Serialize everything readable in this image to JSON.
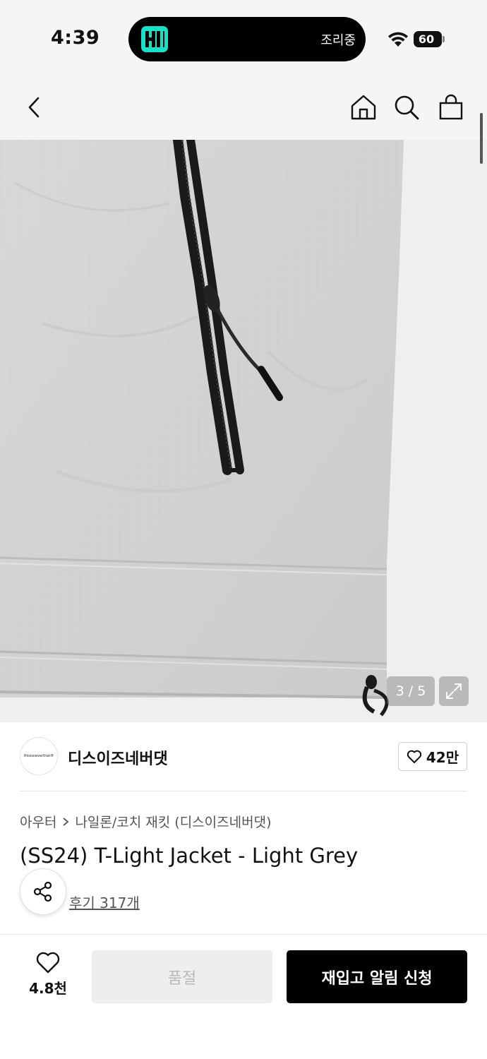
{
  "status_bar": {
    "time": "4:39",
    "island_activity": "조리중",
    "battery_level": "60",
    "island_logo_color": "#19e0c9"
  },
  "nav": {
    "icons": [
      "back-icon",
      "home-icon",
      "search-icon",
      "shopping-bag-icon"
    ]
  },
  "gallery": {
    "page_counter": "3 / 5",
    "current_page": 3,
    "total_pages": 5
  },
  "brand": {
    "logo_text": "thisisneverthat®",
    "name": "디스이즈네버댓",
    "like_count": "42만"
  },
  "product": {
    "breadcrumb": [
      "아우터",
      "나일론/코치 재킷 (디스이즈네버댓)"
    ],
    "title": "(SS24) T-Light Jacket - Light Grey",
    "review_link": "후기 317개"
  },
  "bottom_bar": {
    "wish_count": "4.8천",
    "soldout_label": "품절",
    "restock_label": "재입고 알림 신청"
  },
  "colors": {
    "primary_button": "#000000",
    "disabled_button": "#eeeeee",
    "disabled_text": "#b9b9b9"
  }
}
